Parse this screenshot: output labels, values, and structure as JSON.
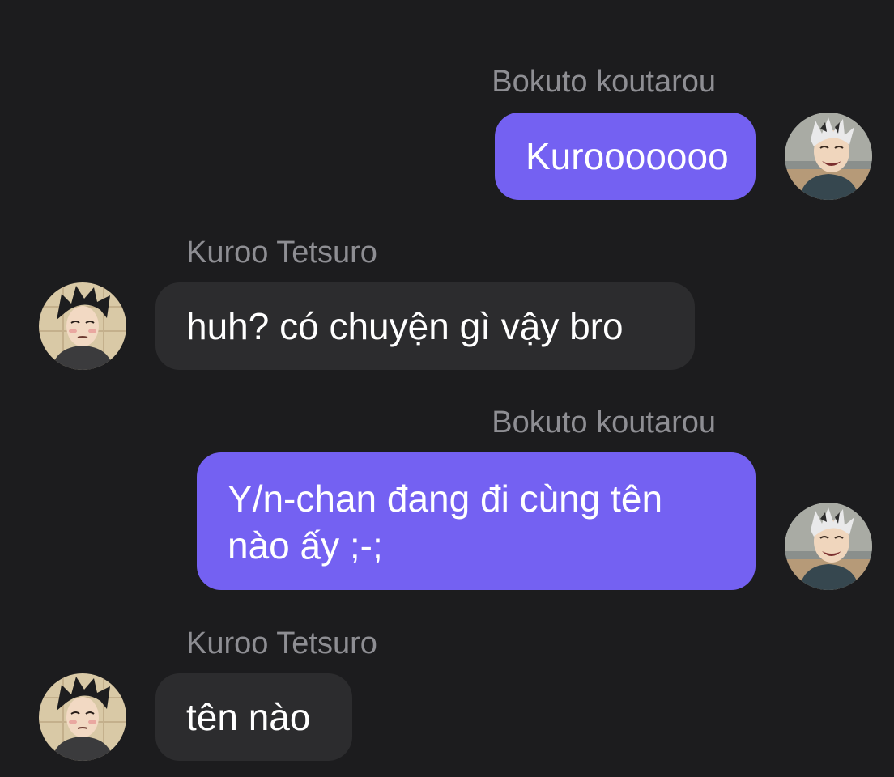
{
  "messages": [
    {
      "sender": "Bokuto koutarou",
      "direction": "outgoing",
      "text": "Kurooooooo",
      "avatar": "bokuto-avatar"
    },
    {
      "sender": "Kuroo Tetsuro",
      "direction": "incoming",
      "text": "huh? có chuyện gì vậy bro",
      "avatar": "kuroo-avatar"
    },
    {
      "sender": "Bokuto koutarou",
      "direction": "outgoing",
      "text_lines": [
        "Y/n-chan đang đi cùng tên",
        "nào ấy ;-;"
      ],
      "avatar": "bokuto-avatar"
    },
    {
      "sender": "Kuroo Tetsuro",
      "direction": "incoming",
      "text": "tên nào",
      "avatar": "kuroo-avatar"
    }
  ],
  "colors": {
    "background": "#1c1c1e",
    "outgoing_bubble": "#7461f2",
    "incoming_bubble": "#2c2c2e",
    "sender_name": "#8e8e93",
    "message_text": "#ffffff"
  }
}
